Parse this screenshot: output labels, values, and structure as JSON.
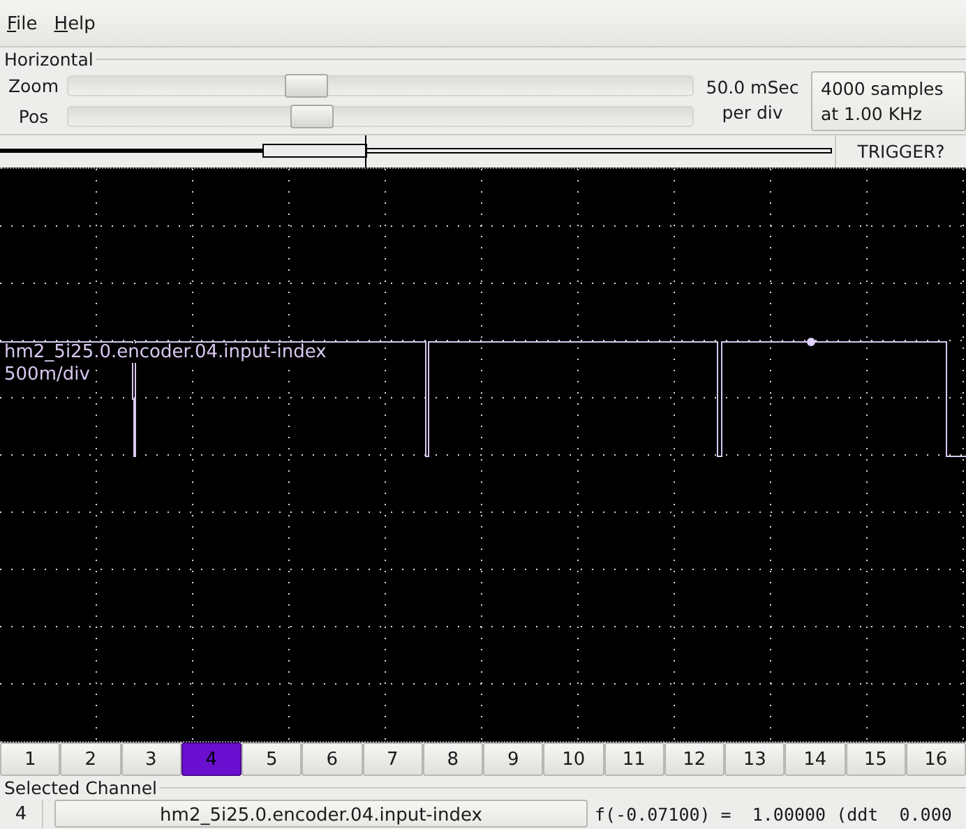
{
  "menu": [
    {
      "label": "File"
    },
    {
      "label": "Help"
    }
  ],
  "horizontal": {
    "title": "Horizontal",
    "sliders": [
      {
        "label": "Zoom",
        "level": 0.38
      },
      {
        "label": "Pos",
        "level": 0.39
      }
    ],
    "time_per_div": [
      "50.0 mSec",
      "per div"
    ],
    "samples": [
      "4000 samples",
      "at 1.00 KHz"
    ]
  },
  "trigger_button": "TRIGGER?",
  "trace": {
    "name": "hm2_5i25.0.encoder.04.input-index",
    "scale": "500m/div"
  },
  "channels": [
    {
      "label": "1",
      "selected": false
    },
    {
      "label": "2",
      "selected": false
    },
    {
      "label": "3",
      "selected": false
    },
    {
      "label": "4",
      "selected": true
    },
    {
      "label": "5",
      "selected": false
    },
    {
      "label": "6",
      "selected": false
    },
    {
      "label": "7",
      "selected": false
    },
    {
      "label": "8",
      "selected": false
    },
    {
      "label": "9",
      "selected": false
    },
    {
      "label": "10",
      "selected": false
    },
    {
      "label": "11",
      "selected": false
    },
    {
      "label": "12",
      "selected": false
    },
    {
      "label": "13",
      "selected": false
    },
    {
      "label": "14",
      "selected": false
    },
    {
      "label": "15",
      "selected": false
    },
    {
      "label": "16",
      "selected": false
    }
  ],
  "selected_channel": {
    "title": "Selected Channel",
    "number": "4",
    "name": "hm2_5i25.0.encoder.04.input-index",
    "readout": "f(-0.07100) =  1.00000 (ddt  0.000"
  }
}
